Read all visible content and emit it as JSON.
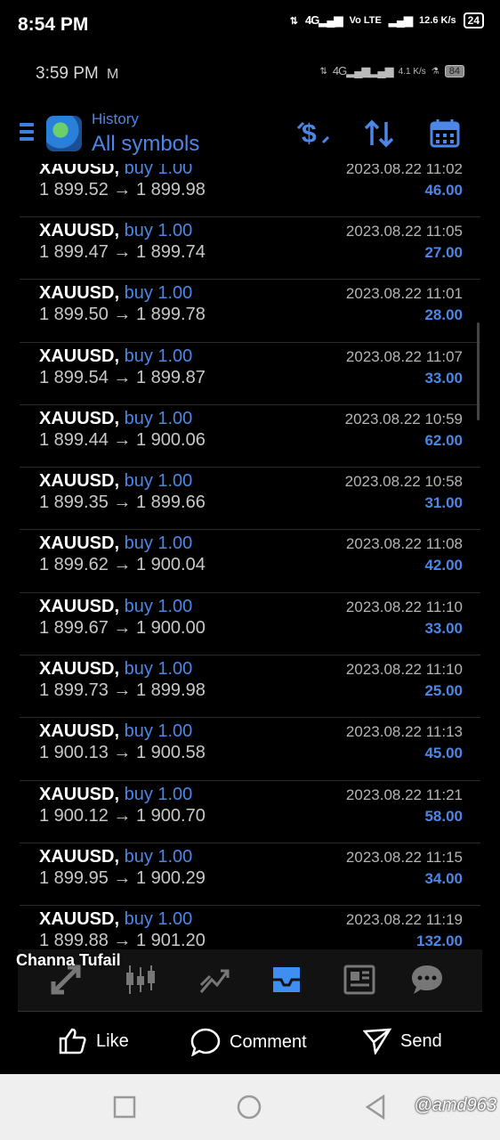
{
  "outer_status": {
    "time": "8:54 PM",
    "network": "4G",
    "volte": "Vo LTE",
    "speed": "12.6 K/s",
    "battery": "24"
  },
  "inner_status": {
    "time": "3:59 PM",
    "mail_icon": "gmail-icon",
    "network": "4G",
    "speed": "4.1 K/s",
    "battery": "84"
  },
  "header": {
    "subtitle": "History",
    "title": "All symbols"
  },
  "colors": {
    "accent": "#4c86e6",
    "background": "#000000"
  },
  "trades": [
    {
      "symbol": "XAUUSD,",
      "direction": "buy 1.00",
      "prices": "1 899.52 → 1 899.98",
      "datetime": "2023.08.22 11:02",
      "profit": "46.00"
    },
    {
      "symbol": "XAUUSD,",
      "direction": "buy 1.00",
      "prices": "1 899.47 → 1 899.74",
      "datetime": "2023.08.22 11:05",
      "profit": "27.00"
    },
    {
      "symbol": "XAUUSD,",
      "direction": "buy 1.00",
      "prices": "1 899.50 → 1 899.78",
      "datetime": "2023.08.22 11:01",
      "profit": "28.00"
    },
    {
      "symbol": "XAUUSD,",
      "direction": "buy 1.00",
      "prices": "1 899.54 → 1 899.87",
      "datetime": "2023.08.22 11:07",
      "profit": "33.00"
    },
    {
      "symbol": "XAUUSD,",
      "direction": "buy 1.00",
      "prices": "1 899.44 → 1 900.06",
      "datetime": "2023.08.22 10:59",
      "profit": "62.00"
    },
    {
      "symbol": "XAUUSD,",
      "direction": "buy 1.00",
      "prices": "1 899.35 → 1 899.66",
      "datetime": "2023.08.22 10:58",
      "profit": "31.00"
    },
    {
      "symbol": "XAUUSD,",
      "direction": "buy 1.00",
      "prices": "1 899.62 → 1 900.04",
      "datetime": "2023.08.22 11:08",
      "profit": "42.00"
    },
    {
      "symbol": "XAUUSD,",
      "direction": "buy 1.00",
      "prices": "1 899.67 → 1 900.00",
      "datetime": "2023.08.22 11:10",
      "profit": "33.00"
    },
    {
      "symbol": "XAUUSD,",
      "direction": "buy 1.00",
      "prices": "1 899.73 → 1 899.98",
      "datetime": "2023.08.22 11:10",
      "profit": "25.00"
    },
    {
      "symbol": "XAUUSD,",
      "direction": "buy 1.00",
      "prices": "1 900.13 → 1 900.58",
      "datetime": "2023.08.22 11:13",
      "profit": "45.00"
    },
    {
      "symbol": "XAUUSD,",
      "direction": "buy 1.00",
      "prices": "1 900.12 → 1 900.70",
      "datetime": "2023.08.22 11:21",
      "profit": "58.00"
    },
    {
      "symbol": "XAUUSD,",
      "direction": "buy 1.00",
      "prices": "1 899.95 → 1 900.29",
      "datetime": "2023.08.22 11:15",
      "profit": "34.00"
    },
    {
      "symbol": "XAUUSD,",
      "direction": "buy 1.00",
      "prices": "1 899.88 → 1 901.20",
      "datetime": "2023.08.22 11:19",
      "profit": "132.00"
    }
  ],
  "bottom_nav": {
    "items": [
      "quotes-icon",
      "chart-icon",
      "trade-icon",
      "history-icon",
      "news-icon",
      "chat-icon"
    ],
    "active": "history-icon"
  },
  "post": {
    "author": "Channa Tufail",
    "like": "Like",
    "comment": "Comment",
    "send": "Send"
  },
  "watermark": "@amd963"
}
